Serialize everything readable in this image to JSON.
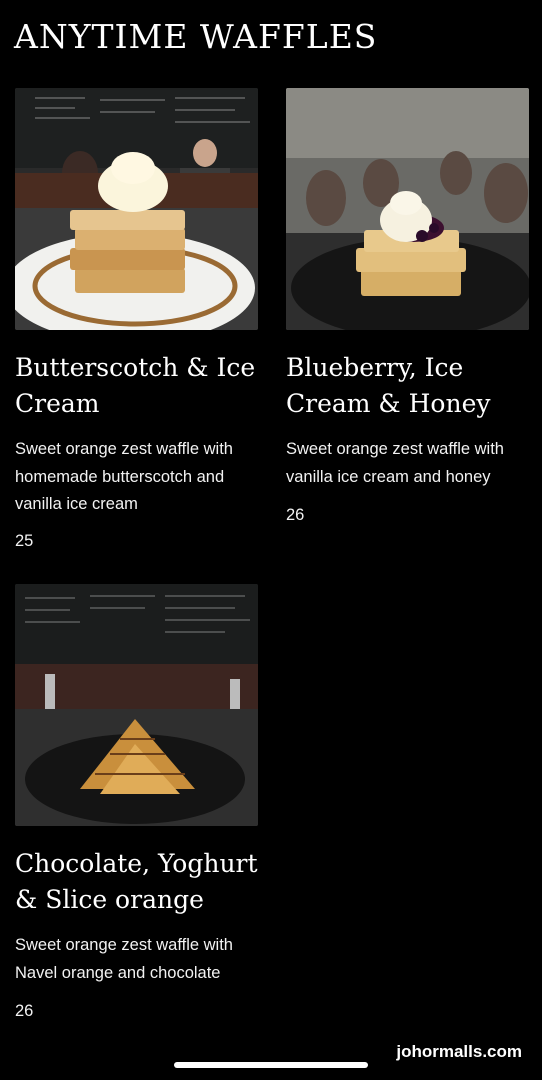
{
  "section": {
    "title": "ANYTIME WAFFLES"
  },
  "items": [
    {
      "name": "Butterscotch & Ice Cream",
      "description": "Sweet orange zest waffle with homemade butterscotch and vanilla ice cream",
      "price": "25"
    },
    {
      "name": "Blueberry, Ice Cream & Honey",
      "description": "Sweet orange zest waffle with vanilla ice cream and honey",
      "price": "26"
    },
    {
      "name": "Chocolate, Yoghurt & Slice orange",
      "description": "Sweet orange zest waffle with Navel orange and chocolate",
      "price": "26"
    }
  ],
  "watermark": "johormalls.com"
}
